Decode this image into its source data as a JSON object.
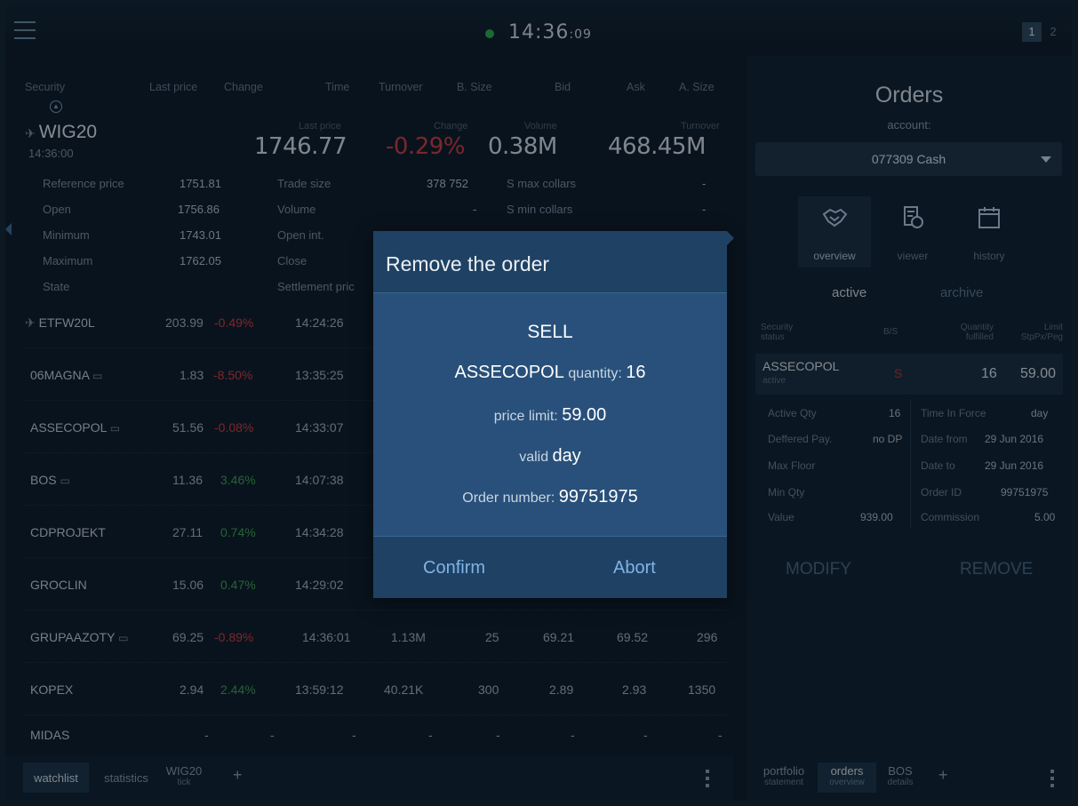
{
  "topbar": {
    "clock_main": "14:36",
    "clock_sec": ":09",
    "screens": [
      "1",
      "2"
    ]
  },
  "watchlist": {
    "columns": [
      "Security",
      "Last price",
      "Change",
      "Time",
      "Turnover",
      "B. Size",
      "Bid",
      "Ask",
      "A. Size"
    ],
    "index": {
      "name": "WIG20",
      "time": "14:36:00",
      "labels": {
        "last": "Last price",
        "change": "Change",
        "volume": "Volume",
        "turnover": "Turnover"
      },
      "last_price": "1746.77",
      "change": "-0.29%",
      "volume": "0.38M",
      "turnover": "468.45M"
    },
    "details_left": [
      {
        "label": "Reference price",
        "value": "1751.81"
      },
      {
        "label": "Open",
        "value": "1756.86"
      },
      {
        "label": "Minimum",
        "value": "1743.01"
      },
      {
        "label": "Maximum",
        "value": "1762.05"
      },
      {
        "label": "State",
        "value": ""
      }
    ],
    "details_mid": [
      {
        "label": "Trade size",
        "value": "378 752"
      },
      {
        "label": "Volume",
        "value": "-"
      },
      {
        "label": "Open int.",
        "value": ""
      },
      {
        "label": "Close",
        "value": ""
      },
      {
        "label": "Settlement pric",
        "value": ""
      }
    ],
    "details_right": [
      {
        "label": "S max collars",
        "value": "-"
      },
      {
        "label": "S min collars",
        "value": "-"
      }
    ],
    "rows": [
      {
        "sym": "ETFW20L",
        "last": "203.99",
        "chg": "-0.49%",
        "time": "14:24:26",
        "turnover": "",
        "bsize": "",
        "bid": "",
        "ask": "",
        "asize": ""
      },
      {
        "sym": "06MAGNA",
        "last": "1.83",
        "chg": "-8.50%",
        "time": "13:35:25",
        "turnover": "",
        "bsize": "",
        "bid": "",
        "ask": "",
        "asize": ""
      },
      {
        "sym": "ASSECOPOL",
        "last": "51.56",
        "chg": "-0.08%",
        "time": "14:33:07",
        "turnover": "",
        "bsize": "",
        "bid": "",
        "ask": "",
        "asize": ""
      },
      {
        "sym": "BOS",
        "last": "11.36",
        "chg": "3.46%",
        "time": "14:07:38",
        "turnover": "",
        "bsize": "",
        "bid": "",
        "ask": "",
        "asize": ""
      },
      {
        "sym": "CDPROJEKT",
        "last": "27.11",
        "chg": "0.74%",
        "time": "14:34:28",
        "turnover": "",
        "bsize": "",
        "bid": "",
        "ask": "",
        "asize": ""
      },
      {
        "sym": "GROCLIN",
        "last": "15.06",
        "chg": "0.47%",
        "time": "14:29:02",
        "turnover": "",
        "bsize": "",
        "bid": "",
        "ask": "",
        "asize": ""
      },
      {
        "sym": "GRUPAAZOTY",
        "last": "69.25",
        "chg": "-0.89%",
        "time": "14:36:01",
        "turnover": "1.13M",
        "bsize": "25",
        "bid": "69.21",
        "ask": "69.52",
        "asize": "296"
      },
      {
        "sym": "KOPEX",
        "last": "2.94",
        "chg": "2.44%",
        "time": "13:59:12",
        "turnover": "40.21K",
        "bsize": "300",
        "bid": "2.89",
        "ask": "2.93",
        "asize": "1350"
      },
      {
        "sym": "MIDAS",
        "last": "-",
        "chg": "-",
        "time": "-",
        "turnover": "-",
        "bsize": "-",
        "bid": "-",
        "ask": "-",
        "asize": "-"
      }
    ],
    "tabs": {
      "watchlist": "watchlist",
      "statistics": "statistics",
      "wig20_top": "WIG20",
      "wig20_bottom": "tick",
      "plus": "+"
    }
  },
  "orders": {
    "title": "Orders",
    "account_label": "account:",
    "account_value": "077309 Cash",
    "views": [
      "overview",
      "viewer",
      "history"
    ],
    "filters": {
      "active": "active",
      "archive": "archive"
    },
    "headers": {
      "security": "Security",
      "status": "status",
      "bs": "B/S",
      "quantity": "Quantity",
      "fulfilled": "fulfilled",
      "limit": "Limit",
      "stppx": "StpPx/Peg"
    },
    "order": {
      "security": "ASSECOPOL",
      "status": "active",
      "side": "S",
      "quantity": "16",
      "limit": "59.00"
    },
    "details_left": [
      {
        "label": "Active Qty",
        "value": "16"
      },
      {
        "label": "Deffered Pay.",
        "value": "no DP"
      },
      {
        "label": "Max Floor",
        "value": ""
      },
      {
        "label": "Min Qty",
        "value": ""
      },
      {
        "label": "Value",
        "value": "939.00"
      }
    ],
    "details_right": [
      {
        "label": "Time In Force",
        "value": "day"
      },
      {
        "label": "Date from",
        "value": "29 Jun 2016"
      },
      {
        "label": "Date to",
        "value": "29 Jun 2016"
      },
      {
        "label": "Order ID",
        "value": "99751975"
      },
      {
        "label": "Commission",
        "value": "5.00"
      }
    ],
    "actions": {
      "modify": "MODIFY",
      "remove": "REMOVE"
    },
    "tabs": {
      "portfolio_top": "portfolio",
      "portfolio_bottom": "statement",
      "orders_top": "orders",
      "orders_bottom": "overview",
      "bos_top": "BOS",
      "bos_bottom": "details",
      "plus": "+"
    }
  },
  "modal": {
    "title": "Remove the order",
    "side": "SELL",
    "security": "ASSECOPOL",
    "quantity_label": "quantity:",
    "quantity": "16",
    "price_label": "price limit:",
    "price": "59.00",
    "valid_label": "valid",
    "valid": "day",
    "order_number_label": "Order number:",
    "order_number": "99751975",
    "confirm": "Confirm",
    "abort": "Abort"
  },
  "colors": {
    "negative": "#d23e3e",
    "positive": "#3fa64f",
    "accent": "#7fb4e8",
    "modal": "#28507a"
  }
}
